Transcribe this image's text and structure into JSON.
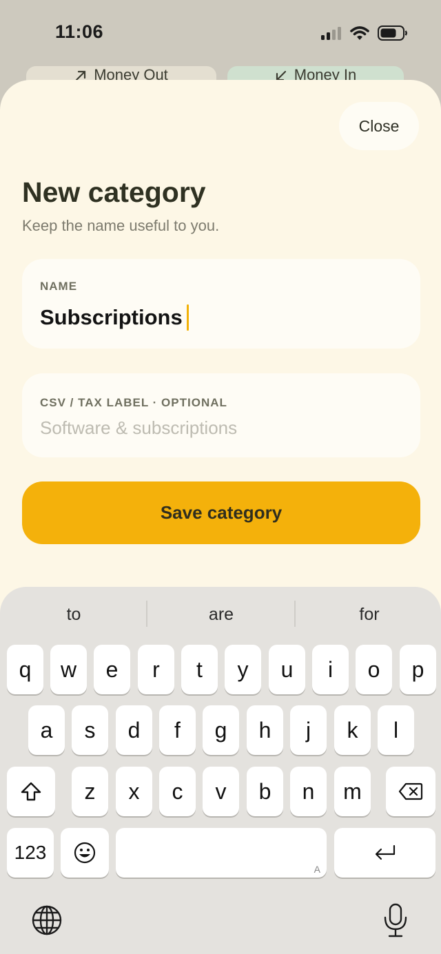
{
  "status_bar": {
    "time": "11:06"
  },
  "background_tabs": {
    "money_out": "Money Out",
    "money_in": "Money In"
  },
  "sheet": {
    "close_label": "Close",
    "title": "New category",
    "subtitle": "Keep the name useful to you.",
    "name_field": {
      "label": "NAME",
      "value": "Subscriptions"
    },
    "tax_field": {
      "label": "CSV / TAX LABEL · OPTIONAL",
      "placeholder": "Software & subscriptions"
    },
    "save_label": "Save category"
  },
  "keyboard": {
    "suggestions": [
      "to",
      "are",
      "for"
    ],
    "row1": [
      "q",
      "w",
      "e",
      "r",
      "t",
      "y",
      "u",
      "i",
      "o",
      "p"
    ],
    "row2": [
      "a",
      "s",
      "d",
      "f",
      "g",
      "h",
      "j",
      "k",
      "l"
    ],
    "row3": [
      "z",
      "x",
      "c",
      "v",
      "b",
      "n",
      "m"
    ],
    "numbers_label": "123",
    "space_hint": "A"
  },
  "icons": {
    "signal": "cellular-signal-icon",
    "wifi": "wifi-icon",
    "battery": "battery-icon",
    "money_out": "arrow-up-right-icon",
    "money_in": "arrow-down-left-icon",
    "shift": "shift-icon",
    "delete": "delete-icon",
    "emoji": "emoji-icon",
    "return": "return-icon",
    "globe": "globe-icon",
    "mic": "microphone-icon"
  },
  "colors": {
    "accent": "#f4b10b",
    "sheet_bg": "#fdf7e6",
    "caret": "#f2b208",
    "money_in_tab": "#cfe0cf"
  }
}
